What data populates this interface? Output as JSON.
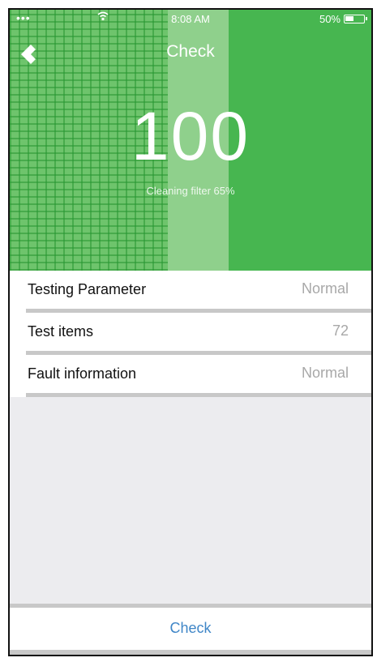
{
  "status_bar": {
    "signal": "•••",
    "time": "8:08 AM",
    "battery": "50%",
    "battery_level": 0.5
  },
  "nav": {
    "title": "Check",
    "back_icon": "back-arrow-icon"
  },
  "hero": {
    "score": "100",
    "filter_text": "Cleaning filter 65%"
  },
  "list": {
    "items": [
      {
        "label": "Testing Parameter",
        "value": "Normal"
      },
      {
        "label": "Test items",
        "value": "72"
      },
      {
        "label": "Fault information",
        "value": "Normal"
      }
    ]
  },
  "footer": {
    "check_label": "Check"
  },
  "colors": {
    "hero_green": "#47b650",
    "action_blue": "#3f86c7"
  }
}
